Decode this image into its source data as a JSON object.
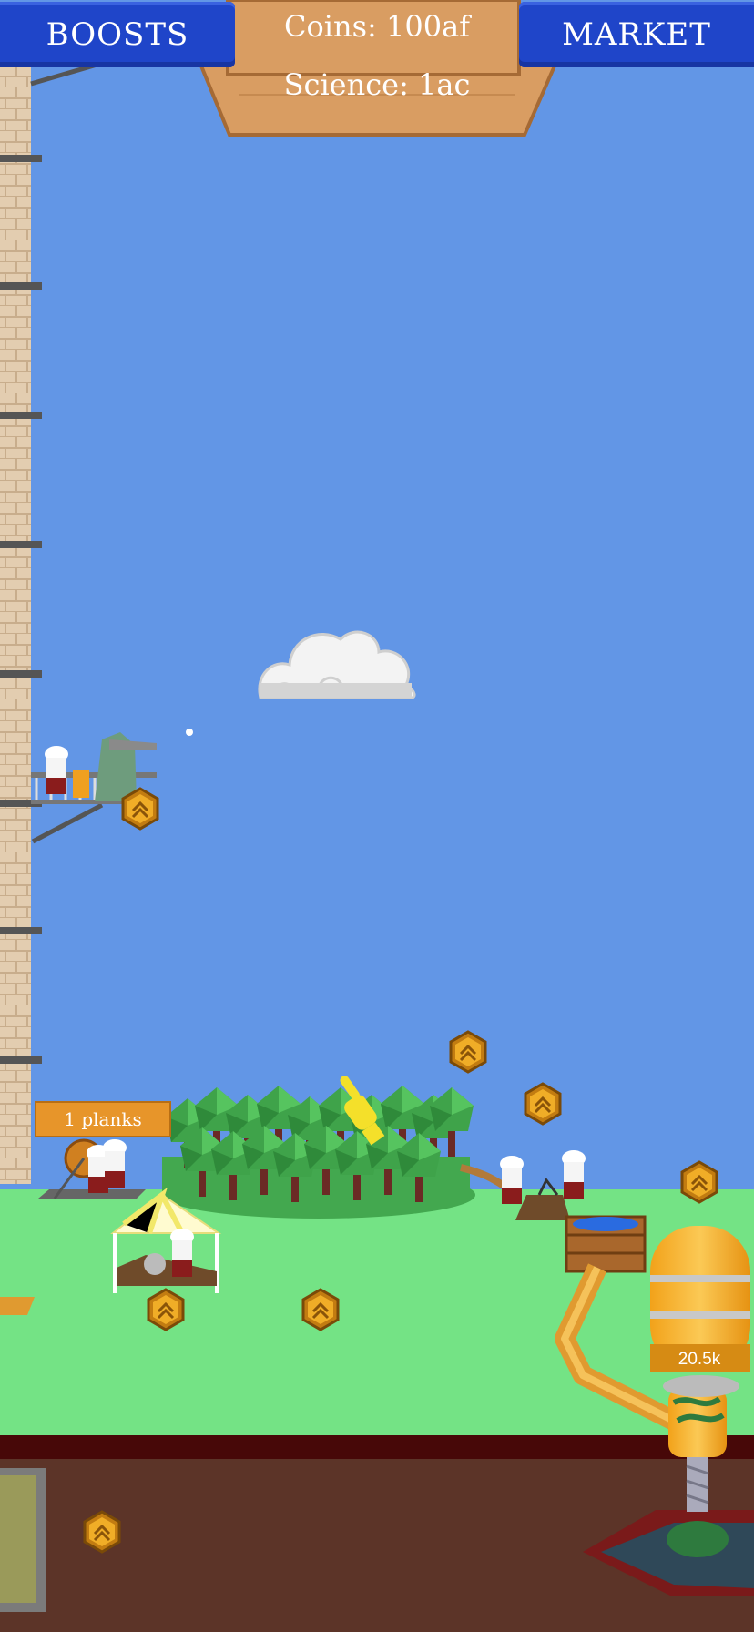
{
  "hud": {
    "boosts_label": "BOOSTS",
    "market_label": "MARKET",
    "coins_text": "Coins:  100af",
    "science_text": "Science:  1ac"
  },
  "scene": {
    "planks_label": "1 planks",
    "tank_value": "20.5k"
  },
  "icons": [
    "upgrade-chevron-icon",
    "tap-hand-icon",
    "cloud-icon"
  ],
  "colors": {
    "sky": "#6296e6",
    "grass": "#74e385",
    "soil": "#5c3428",
    "button_blue": "#1f45c9",
    "sign_wood": "#d99d62",
    "upgrade_gold": "#e9a21d"
  }
}
